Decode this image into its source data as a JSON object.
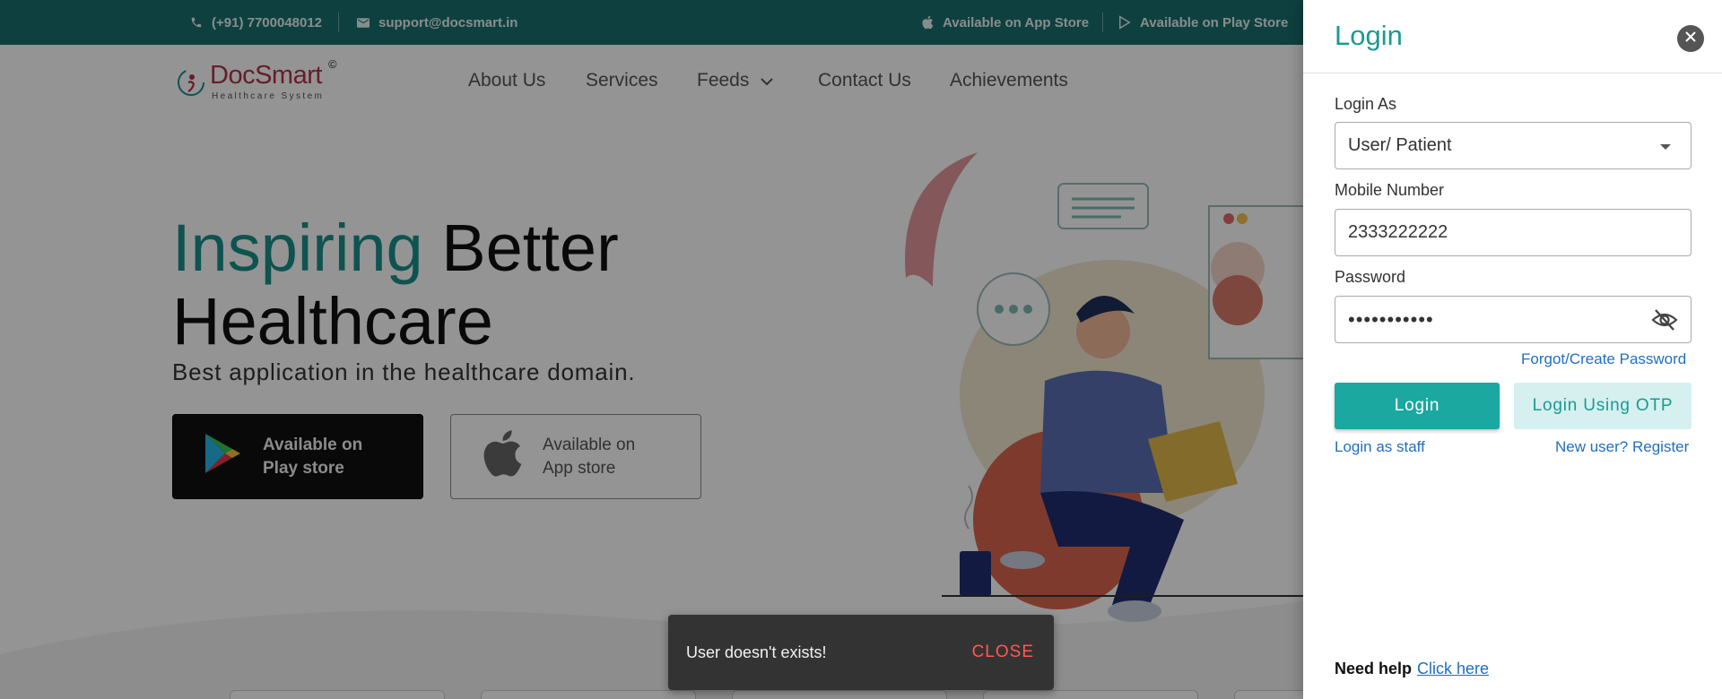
{
  "topbar": {
    "phone": "(+91) 7700048012",
    "email": "support@docsmart.in",
    "app_store": "Available on App Store",
    "play_store": "Available on Play Store"
  },
  "header": {
    "logo_name_doc": "Doc",
    "logo_name_smart": "Smart",
    "logo_copyright": "©",
    "logo_tagline": "Healthcare System",
    "nav": {
      "about": "About Us",
      "services": "Services",
      "feeds": "Feeds",
      "contact": "Contact Us",
      "achievements": "Achievements"
    }
  },
  "hero": {
    "title_accent": "Inspiring",
    "title_rest": " Better",
    "title_line2": "Healthcare",
    "subtitle": "Best application in the healthcare domain.",
    "play_btn_line1": "Available on",
    "play_btn_line2": "Play store",
    "app_btn_line1": "Available on",
    "app_btn_line2": "App store"
  },
  "snackbar": {
    "message": "User doesn't exists!",
    "close_label": "CLOSE"
  },
  "login": {
    "title": "Login",
    "login_as_label": "Login As",
    "login_as_value": "User/ Patient",
    "mobile_label": "Mobile Number",
    "mobile_value": "2333222222",
    "password_label": "Password",
    "password_value": "•••••••••••",
    "forgot_link": "Forgot/Create Password",
    "login_button": "Login",
    "otp_button": "Login Using OTP",
    "staff_link": "Login as staff",
    "register_link": "New user? Register",
    "need_help": "Need help",
    "click_here": "Click here"
  },
  "colors": {
    "brand_teal": "#1b6f6e",
    "accent_teal": "#1aa8a0",
    "logo_red": "#b03548",
    "link_blue": "#1f6fc2",
    "snackbar_close": "#ff5a4e"
  }
}
